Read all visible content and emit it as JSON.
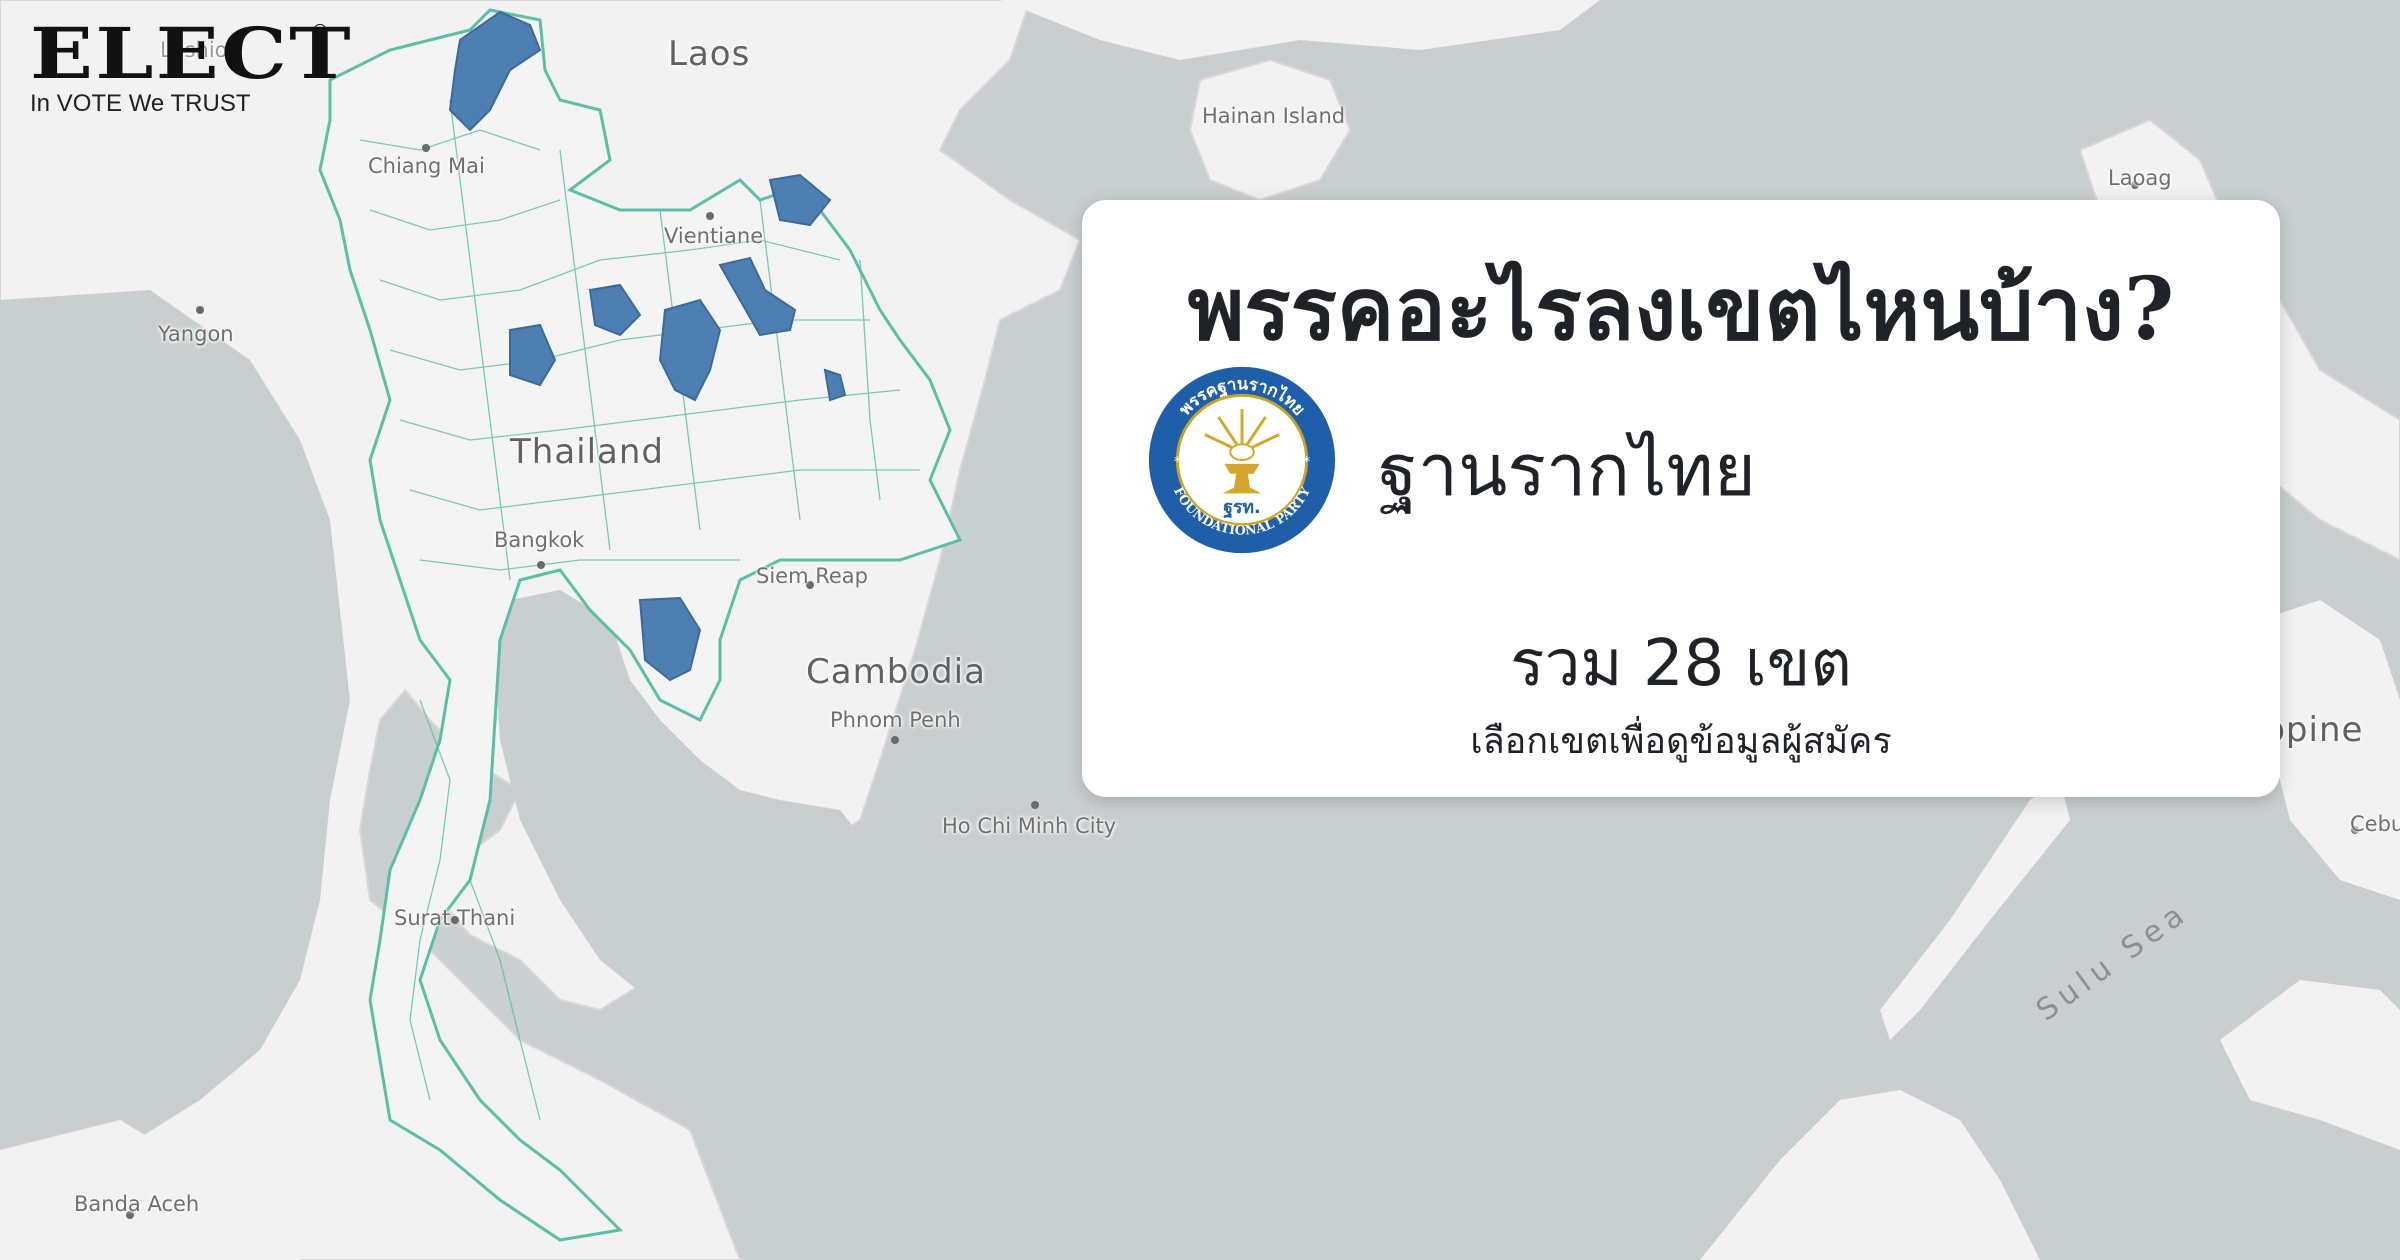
{
  "brand": {
    "name": "ELECT",
    "copyright_mark": "©",
    "tagline": "In VOTE We TRUST"
  },
  "map": {
    "places": {
      "laos": "Laos",
      "thailand": "Thailand",
      "cambodia": "Cambodia",
      "philippines": "ilippine",
      "hainan": "Hainan Island",
      "laoag": "Laoag",
      "chiang_mai": "Chiang Mai",
      "yangon": "Yangon",
      "vientiane": "Vientiane",
      "bangkok": "Bangkok",
      "siem_reap": "Siem Reap",
      "phnom_penh": "Phnom Penh",
      "ho_chi_minh": "Ho Chi Minh City",
      "surat_thani": "Surat Thani",
      "banda_aceh": "Banda Aceh",
      "cebu": "Cebu",
      "sulu_sea": "Sulu Sea",
      "lashio": "Lashio"
    },
    "colors": {
      "land": "#f2f2f2",
      "water": "#c9cfd1",
      "district_border": "#5bbfa6",
      "highlight": "#4d7fb3"
    }
  },
  "card": {
    "title": "พรรคอะไรลงเขตไหนบ้าง?",
    "party_name": "ฐานรากไทย",
    "district_total": "รวม 28 เขต",
    "select_hint": "เลือกเขตเพื่อดูข้อมูลผู้สมัคร",
    "party_logo": {
      "ring_text": "พรรคฐานรากไทย",
      "bottom_text": "FOUNDATIONAL PARTY",
      "abbreviation": "ฐรท."
    }
  }
}
